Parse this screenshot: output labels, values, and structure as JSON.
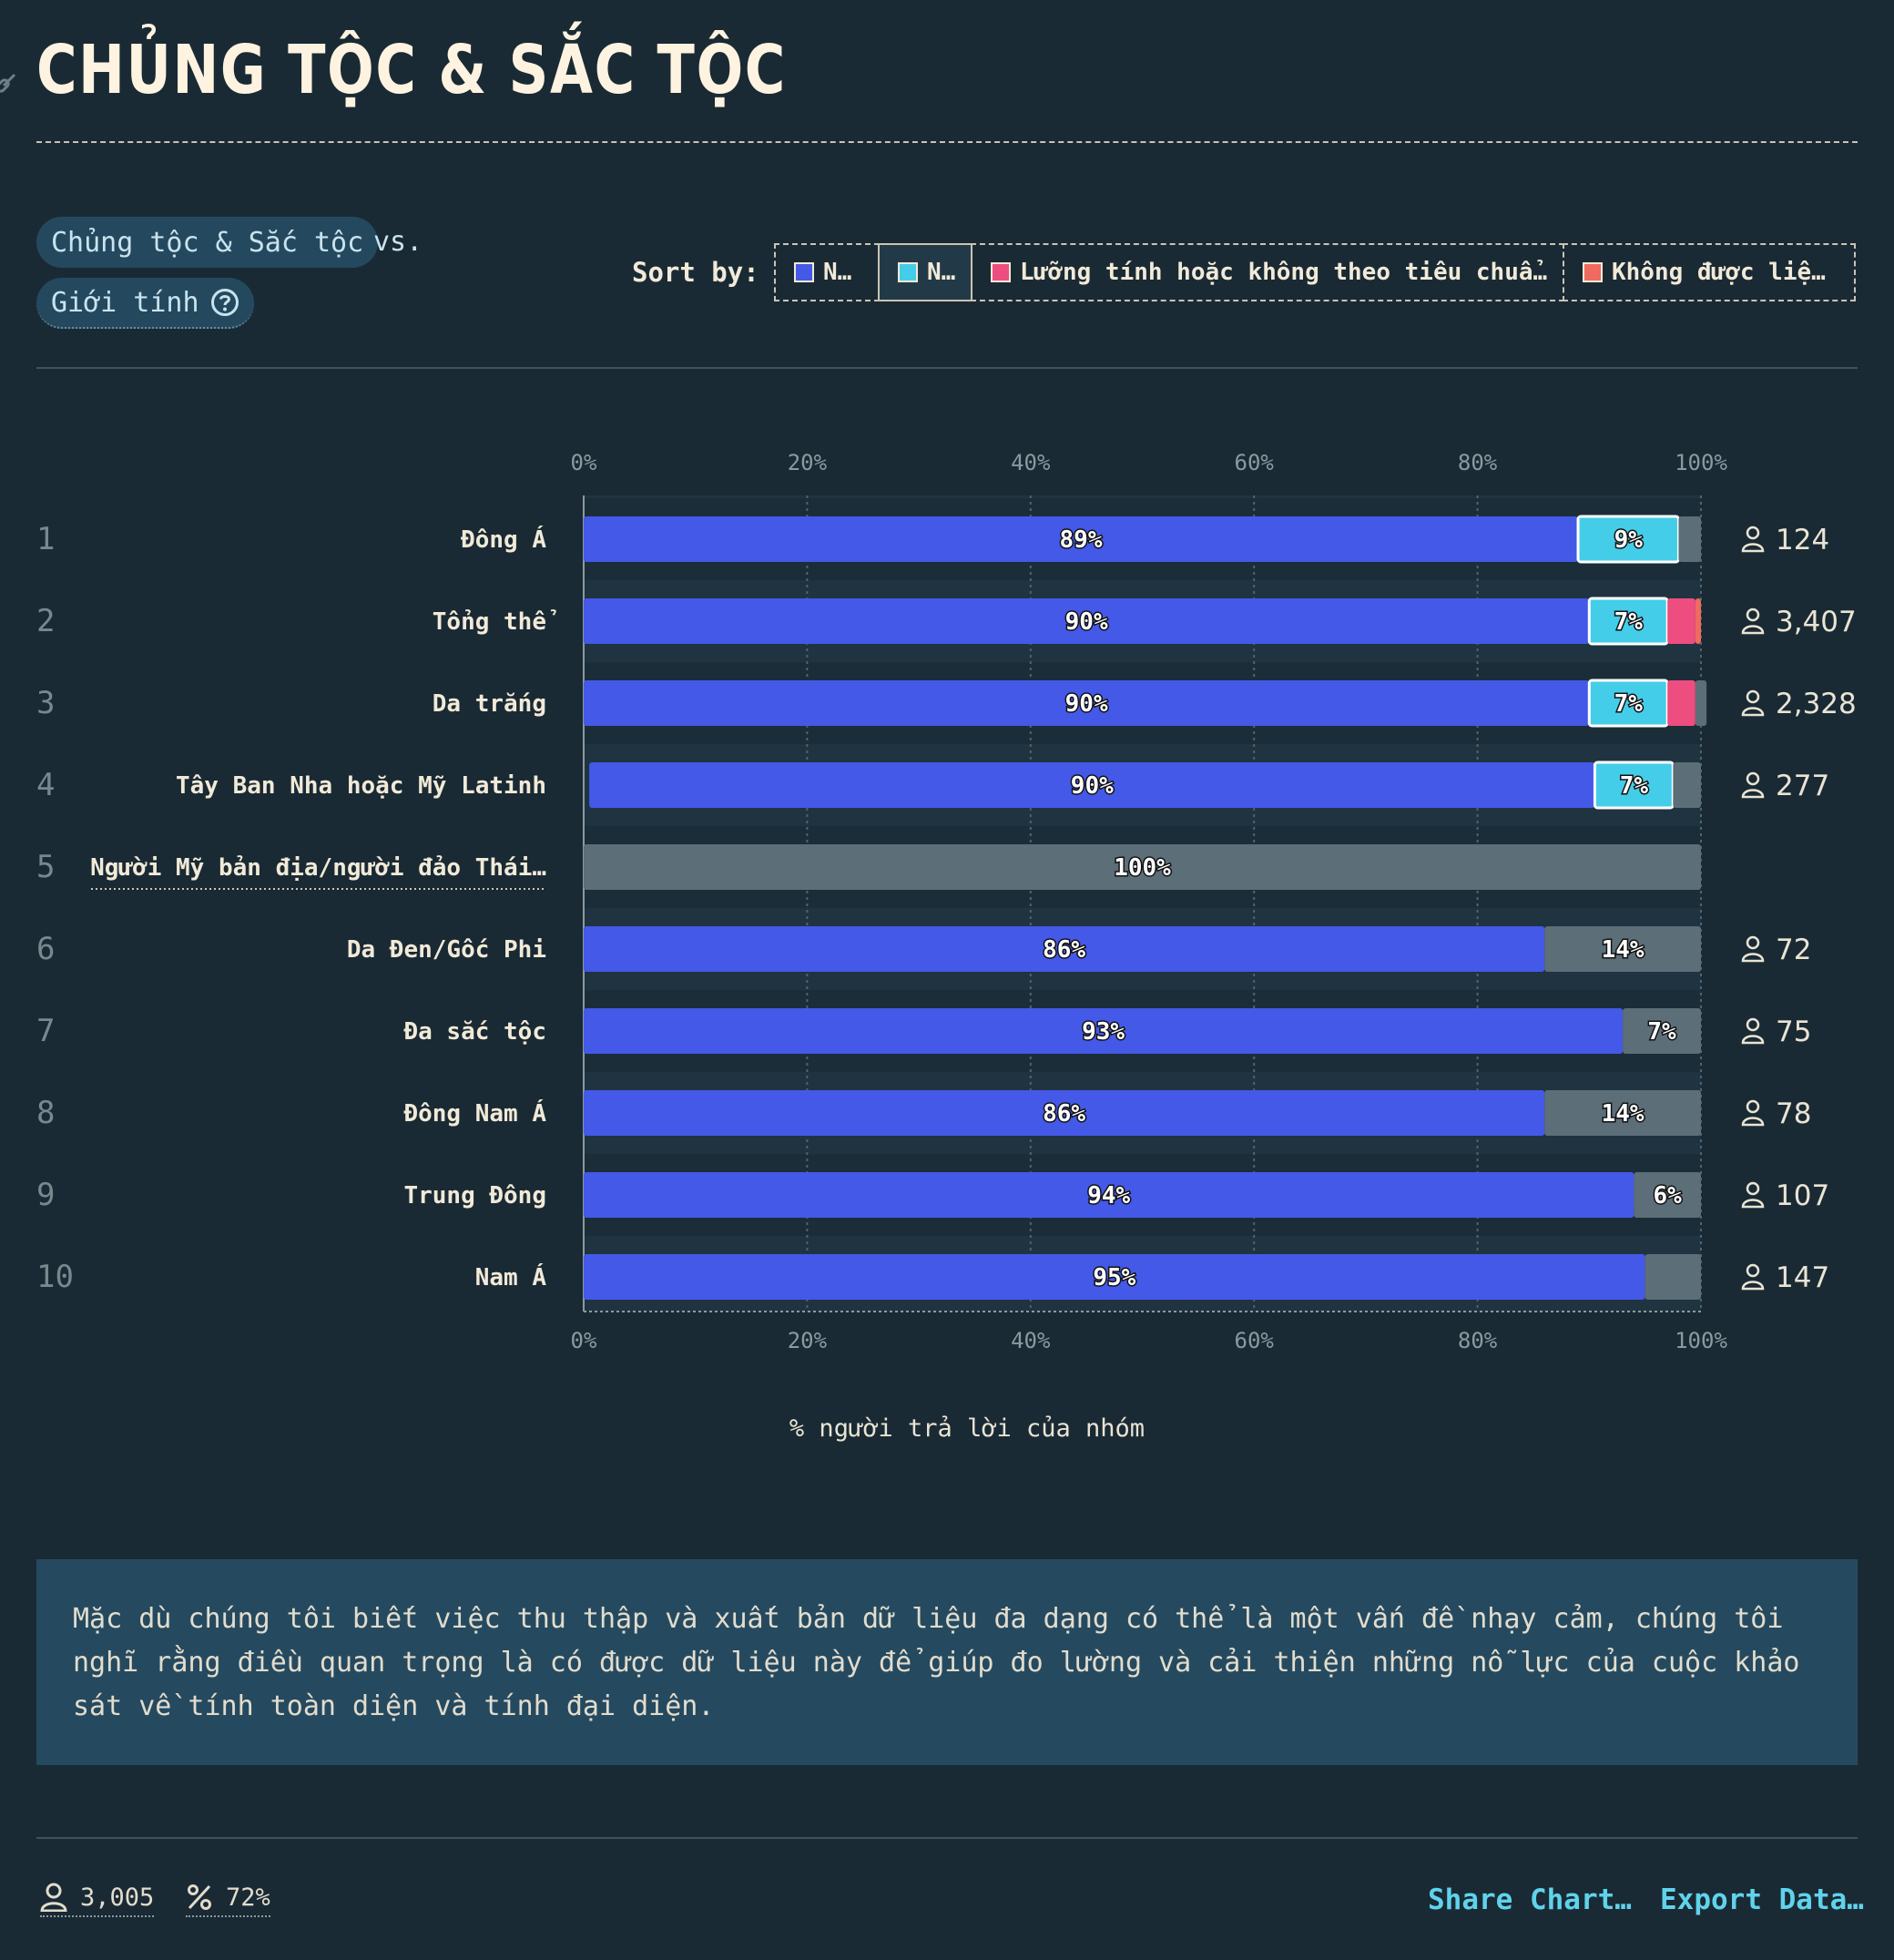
{
  "title": "CHỦNG TỘC & SẮC TỘC",
  "controls": {
    "group_a": "Chủng tộc & Sắc tộc",
    "vs": "vs.",
    "group_b": "Giới tính",
    "sort_label": "Sort by:",
    "sort_options": [
      {
        "label": "N…",
        "color": "#4459e8",
        "active": false
      },
      {
        "label": "N…",
        "color": "#44cde8",
        "active": true
      },
      {
        "label": "Lưỡng tính hoặc không theo tiêu chuẩ…",
        "color": "#ee4d80",
        "active": false
      },
      {
        "label": "Không được liệ…",
        "color": "#f06a5f",
        "active": false
      }
    ]
  },
  "chart_data": {
    "type": "bar",
    "orientation": "horizontal-stacked",
    "xlabel": "% người trả lời của nhóm",
    "xlim": [
      0,
      100
    ],
    "ticks": [
      "0%",
      "20%",
      "40%",
      "60%",
      "80%",
      "100%"
    ],
    "tick_values": [
      0,
      20,
      40,
      60,
      80,
      100
    ],
    "colors": {
      "blue": "#4459e8",
      "cyan": "#44cde8",
      "pink": "#ee4d80",
      "coral": "#f06a5f",
      "gray": "#5c6e78"
    },
    "rows": [
      {
        "rank": "1",
        "label": "Đông Á",
        "count": "124",
        "segments": [
          {
            "value": 89,
            "color": "blue",
            "label": "89%"
          },
          {
            "value": 9,
            "color": "cyan",
            "label": "9%",
            "outlined": true
          },
          {
            "value": 2,
            "color": "gray",
            "label": ""
          }
        ]
      },
      {
        "rank": "2",
        "label": "Tổng thể",
        "count": "3,407",
        "segments": [
          {
            "value": 90,
            "color": "blue",
            "label": "90%"
          },
          {
            "value": 7,
            "color": "cyan",
            "label": "7%",
            "outlined": true
          },
          {
            "value": 2.5,
            "color": "pink",
            "label": ""
          },
          {
            "value": 0.5,
            "color": "coral",
            "label": ""
          }
        ]
      },
      {
        "rank": "3",
        "label": "Da trắng",
        "count": "2,328",
        "segments": [
          {
            "value": 90,
            "color": "blue",
            "label": "90%"
          },
          {
            "value": 7,
            "color": "cyan",
            "label": "7%",
            "outlined": true
          },
          {
            "value": 2.5,
            "color": "pink",
            "label": ""
          },
          {
            "value": 1,
            "color": "gray",
            "label": ""
          }
        ]
      },
      {
        "rank": "4",
        "label": "Tây Ban Nha hoặc Mỹ Latinh",
        "count": "277",
        "segments": [
          {
            "value": 90,
            "color": "blue",
            "label": "90%"
          },
          {
            "value": 7,
            "color": "cyan",
            "label": "7%",
            "outlined": true
          },
          {
            "value": 2.5,
            "color": "gray",
            "label": ""
          }
        ]
      },
      {
        "rank": "5",
        "label": "Người Mỹ bản địa/người đảo Thái…",
        "count": "",
        "underlined": true,
        "segments": [
          {
            "value": 100,
            "color": "gray",
            "label": "100%"
          }
        ]
      },
      {
        "rank": "6",
        "label": "Da Đen/Gốc Phi",
        "count": "72",
        "segments": [
          {
            "value": 86,
            "color": "blue",
            "label": "86%"
          },
          {
            "value": 14,
            "color": "gray",
            "label": "14%"
          }
        ]
      },
      {
        "rank": "7",
        "label": "Đa sắc tộc",
        "count": "75",
        "segments": [
          {
            "value": 93,
            "color": "blue",
            "label": "93%"
          },
          {
            "value": 7,
            "color": "gray",
            "label": "7%"
          }
        ]
      },
      {
        "rank": "8",
        "label": "Đông Nam Á",
        "count": "78",
        "segments": [
          {
            "value": 86,
            "color": "blue",
            "label": "86%"
          },
          {
            "value": 14,
            "color": "gray",
            "label": "14%"
          }
        ]
      },
      {
        "rank": "9",
        "label": "Trung Đông",
        "count": "107",
        "segments": [
          {
            "value": 94,
            "color": "blue",
            "label": "94%"
          },
          {
            "value": 6,
            "color": "gray",
            "label": "6%"
          }
        ]
      },
      {
        "rank": "10",
        "label": "Nam Á",
        "count": "147",
        "segments": [
          {
            "value": 95,
            "color": "blue",
            "label": "95%"
          },
          {
            "value": 5,
            "color": "gray",
            "label": ""
          }
        ]
      }
    ]
  },
  "note": "Mặc dù chúng tôi biết việc thu thập và xuất bản dữ liệu đa dạng có thể là một vấn đề nhạy cảm, chúng tôi nghĩ rằng điều quan trọng là có được dữ liệu này để giúp đo lường và cải thiện những nỗ lực của cuộc khảo sát về tính toàn diện và tính đại diện.",
  "footer": {
    "respondents": "3,005",
    "percent": "72%",
    "share": "Share Chart…",
    "export": "Export Data…"
  }
}
